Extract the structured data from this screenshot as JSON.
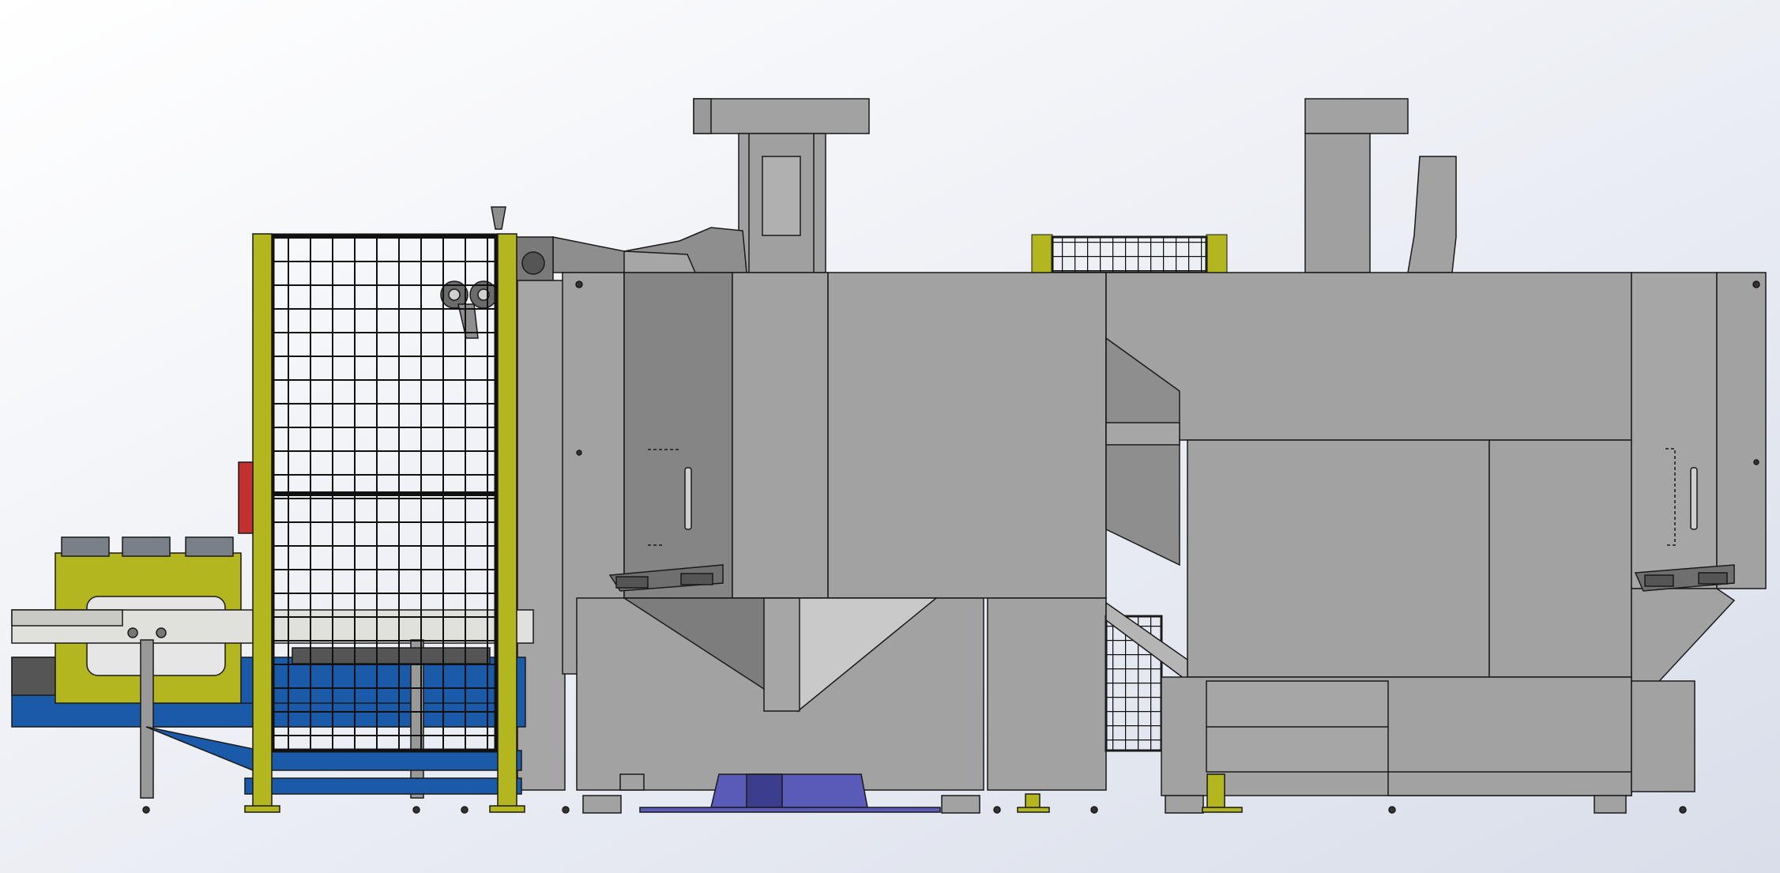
{
  "scene": {
    "description_visible_text": [],
    "colors": {
      "background_top": "#ffffff",
      "background_bottom": "#dde1ec",
      "machine_gray": "#a2a2a2",
      "machine_gray_dark": "#7f7f7f",
      "machine_gray_light": "#c4c4c4",
      "outline": "#1a1a1a",
      "guard_yellow": "#b3b61e",
      "conveyor_blue": "#1a5aa8",
      "base_purple": "#5a5ab8",
      "mesh_black": "#111111",
      "fixture_gray": "#8a8f96"
    },
    "components": [
      {
        "id": "infeed-conveyor",
        "kind": "conveyor"
      },
      {
        "id": "safety-fence",
        "kind": "guard"
      },
      {
        "id": "robot-arm",
        "kind": "robot"
      },
      {
        "id": "main-cabinet",
        "kind": "enclosure"
      },
      {
        "id": "exhaust-stack-left",
        "kind": "duct"
      },
      {
        "id": "exhaust-stack-right",
        "kind": "duct"
      },
      {
        "id": "rear-fence",
        "kind": "guard"
      },
      {
        "id": "hopper",
        "kind": "hopper"
      },
      {
        "id": "support-legs",
        "kind": "frame"
      }
    ]
  }
}
